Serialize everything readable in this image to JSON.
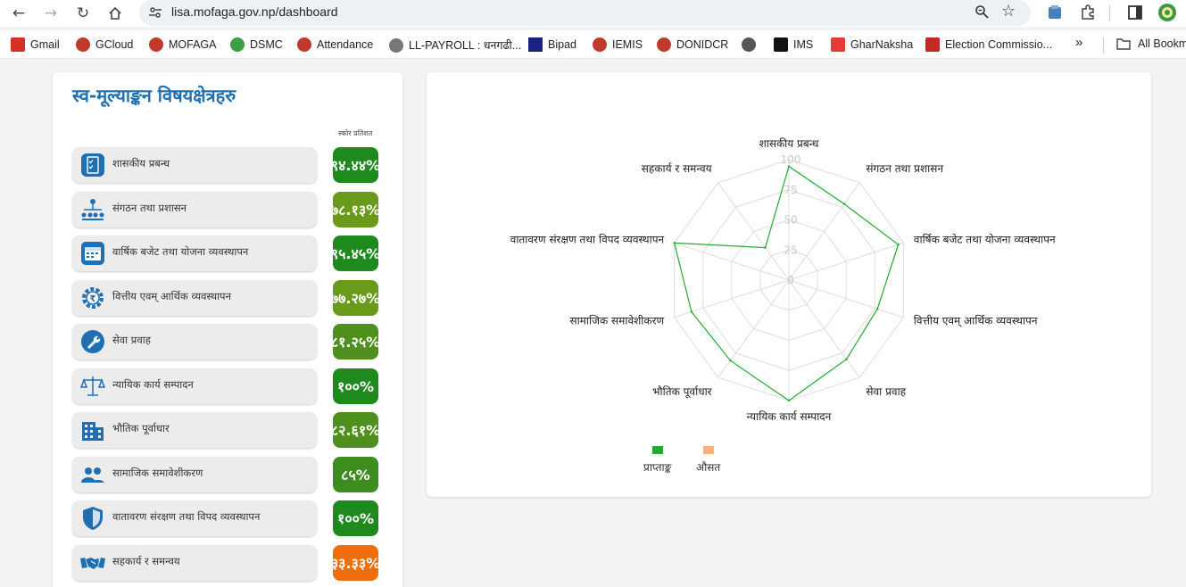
{
  "browser": {
    "url": "lisa.mofaga.gov.np/dashboard",
    "bookmarks": [
      {
        "label": "Gmail",
        "color": "#d93025"
      },
      {
        "label": "GCloud",
        "color": "#c0392b"
      },
      {
        "label": "MOFAGA",
        "color": "#c0392b"
      },
      {
        "label": "DSMC",
        "color": "#3aa043"
      },
      {
        "label": "Attendance",
        "color": "#c0392b"
      },
      {
        "label": "LL-PAYROLL : धनगढी...",
        "color": "#666666"
      },
      {
        "label": "Bipad",
        "color": "#1a237e"
      },
      {
        "label": "IEMIS",
        "color": "#c0392b"
      },
      {
        "label": "DONIDCR",
        "color": "#c0392b"
      },
      {
        "label": "",
        "color": "#555555"
      },
      {
        "label": "IMS",
        "color": "#111111"
      },
      {
        "label": "GharNaksha",
        "color": "#e53935"
      },
      {
        "label": "Election Commissio...",
        "color": "#c62828"
      }
    ],
    "more_label": "»",
    "all_bookmarks_label": "All Bookm"
  },
  "panel": {
    "title": "स्व-मूल्याङ्कन विषयक्षेत्रहरु",
    "score_header": "स्कोर प्रतिशत",
    "items": [
      {
        "label": "शासकीय प्रबन्ध",
        "score": "९४.४४%",
        "color": "#1e8a1e",
        "icon": "checklist-icon"
      },
      {
        "label": "संगठन तथा प्रशासन",
        "score": "७८.१३%",
        "color": "#6a9a1a",
        "icon": "org-chart-icon"
      },
      {
        "label": "वार्षिक बजेट तथा योजना व्यवस्थापन",
        "score": "९५.४५%",
        "color": "#1e8a1e",
        "icon": "calendar-icon"
      },
      {
        "label": "वित्तीय एवम् आर्थिक व्यवस्थापन",
        "score": "७७.२७%",
        "color": "#6a9a1a",
        "icon": "rupee-gear-icon"
      },
      {
        "label": "सेवा प्रवाह",
        "score": "८१.२५%",
        "color": "#4e8f1e",
        "icon": "wrench-icon"
      },
      {
        "label": "न्यायिक कार्य सम्पादन",
        "score": "१००%",
        "color": "#1e8a1e",
        "icon": "scales-icon"
      },
      {
        "label": "भौतिक पूर्वाधार",
        "score": "८२.६१%",
        "color": "#4e8f1e",
        "icon": "building-icon"
      },
      {
        "label": "सामाजिक समावेशीकरण",
        "score": "८५%",
        "color": "#3d8c1e",
        "icon": "people-icon"
      },
      {
        "label": "वातावरण संरक्षण तथा विपद व्यवस्थापन",
        "score": "१००%",
        "color": "#1e8a1e",
        "icon": "shield-icon"
      },
      {
        "label": "सहकार्य र समन्वय",
        "score": "३३.३३%",
        "color": "#f06d0c",
        "icon": "handshake-icon"
      }
    ]
  },
  "chart_data": {
    "type": "radar",
    "categories": [
      "शासकीय प्रबन्ध",
      "संगठन तथा प्रशासन",
      "वार्षिक बजेट तथा योजना व्यवस्थापन",
      "वित्तीय एवम् आर्थिक व्यवस्थापन",
      "सेवा प्रवाह",
      "न्यायिक कार्य सम्पादन",
      "भौतिक पूर्वाधार",
      "सामाजिक समावेशीकरण",
      "वातावरण संरक्षण तथा विपद व्यवस्थापन",
      "सहकार्य र समन्वय"
    ],
    "ticks": [
      "0",
      "25",
      "50",
      "75",
      "100"
    ],
    "rlim": [
      0,
      100
    ],
    "series": [
      {
        "name": "प्राप्ताङ्क",
        "color": "#22aa33",
        "values": [
          94.44,
          78.13,
          95.45,
          77.27,
          81.25,
          100,
          82.61,
          85,
          100,
          33.33
        ]
      },
      {
        "name": "औसत",
        "color": "#f8b27c",
        "values": []
      }
    ],
    "grid": true,
    "legend": "bottom"
  }
}
